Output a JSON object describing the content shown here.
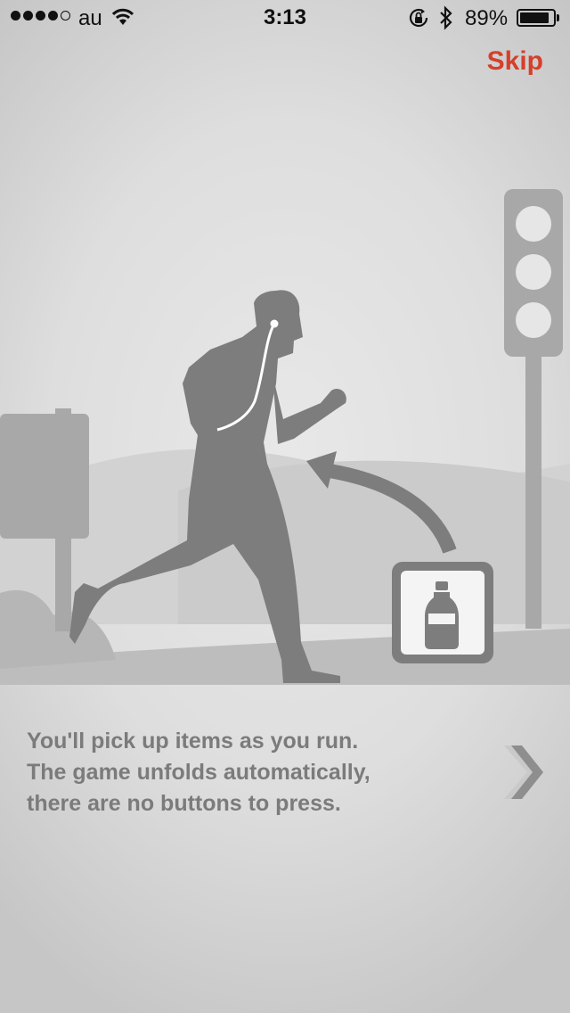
{
  "status_bar": {
    "carrier": "au",
    "time": "3:13",
    "battery_percent": "89%",
    "battery_level": 0.89,
    "signal_bars_filled": 4,
    "signal_bars_total": 5,
    "icons": [
      "wifi-icon",
      "orientation-lock-icon",
      "bluetooth-icon",
      "battery-icon"
    ]
  },
  "header": {
    "skip_label": "Skip"
  },
  "tutorial": {
    "lines": [
      "You'll pick up items as you run.",
      "The game unfolds automatically,",
      "there are no buttons to press."
    ],
    "next_icon": "chevron-right-icon",
    "illustration_items": [
      "runner-figure",
      "earphones",
      "traffic-light",
      "signpost",
      "water-bottle-item",
      "arrow"
    ]
  },
  "colors": {
    "accent": "#d5402b",
    "text_gray": "#7b7b7b",
    "figure_gray": "#7d7d7d"
  }
}
